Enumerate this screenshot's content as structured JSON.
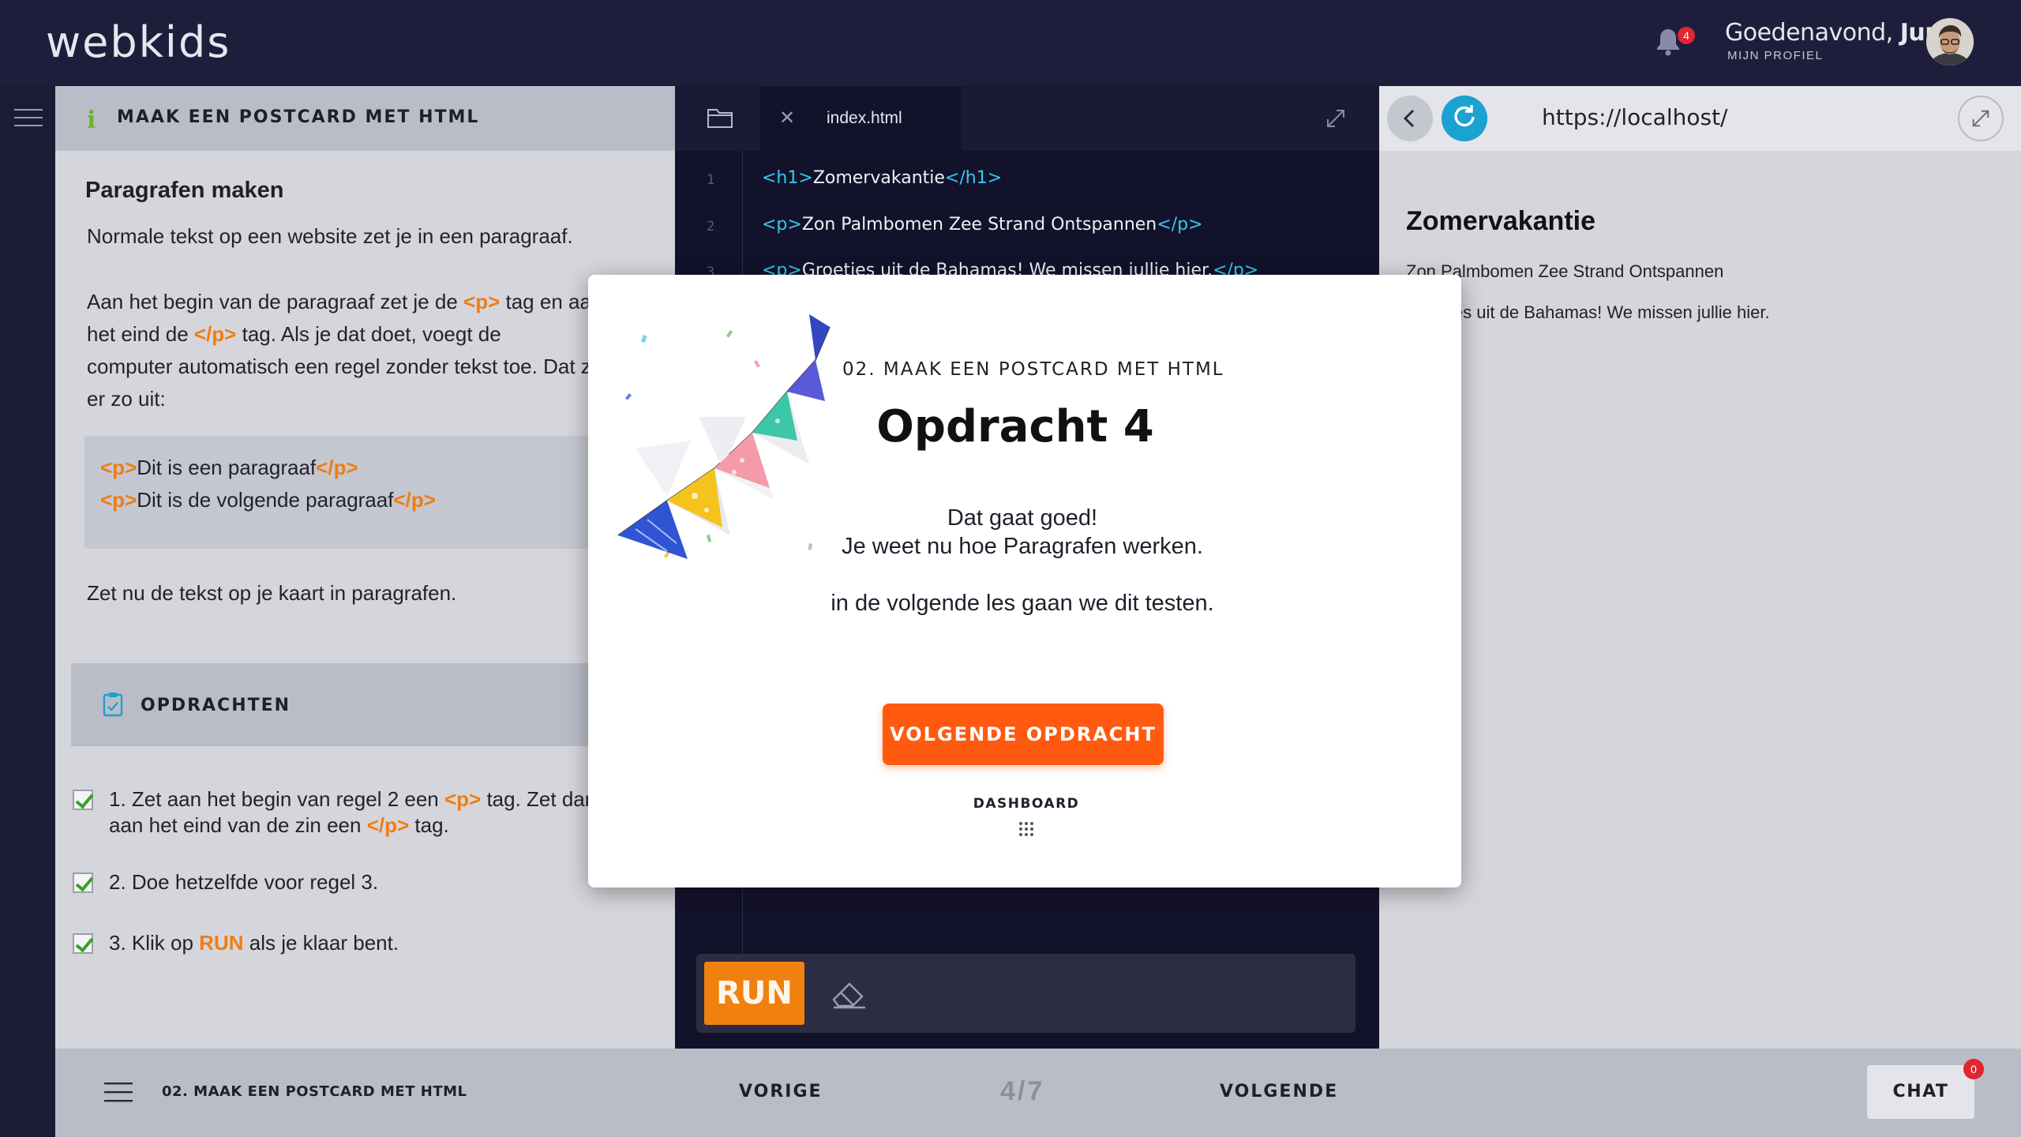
{
  "app": {
    "logo": "webkids",
    "notifications_count": "4",
    "greeting_prefix": "Goedenavond, ",
    "user_name": "Jun",
    "profile_link": "MIJN PROFIEL"
  },
  "instructions": {
    "header_title": "MAAK EEN POSTCARD MET HTML",
    "heading": "Paragrafen maken",
    "para1": "Normale tekst op een website zet je in een paragraaf.",
    "para2_a": "Aan het begin van de paragraaf zet je de ",
    "para2_tag_open": "<p>",
    "para2_b": " tag en aan",
    "para2_c": "het eind de ",
    "para2_tag_close": "</p>",
    "para2_d": " tag. Als je dat doet, voegt de",
    "para2_e": "computer automatisch een regel zonder tekst toe. Dat ziet",
    "para2_f": "er zo uit:",
    "example": [
      {
        "open": "<p>",
        "text": "Dit is een paragraaf",
        "close": "</p>"
      },
      {
        "open": "<p>",
        "text": "Dit is de volgende paragraaf",
        "close": "</p>"
      }
    ],
    "para3": "Zet nu de tekst op je kaart in paragrafen.",
    "tasks_label": "OPDRACHTEN",
    "tasks": [
      {
        "a": "1. Zet aan het begin van regel 2 een ",
        "tag1": "<p>",
        "b": " tag. Zet dan",
        "c": "aan het eind van de zin een ",
        "tag2": "</p>",
        "d": " tag."
      },
      {
        "text": "2. Doe hetzelfde voor regel 3."
      },
      {
        "a": "3. Klik op ",
        "run": "RUN",
        "b": " als je klaar bent."
      }
    ]
  },
  "editor": {
    "tab_name": "index.html",
    "lines": [
      {
        "num": "1",
        "open": "<h1>",
        "text": "Zomervakantie",
        "close": "</h1>"
      },
      {
        "num": "2",
        "open": "<p>",
        "text": "Zon Palmbomen Zee Strand Ontspannen",
        "close": "</p>"
      },
      {
        "num": "3",
        "open": "<p>",
        "text": "Groeties uit de Bahamas! We missen jullie hier.",
        "close": "</p>"
      }
    ],
    "run_label": "RUN"
  },
  "preview": {
    "url": "https://localhost/",
    "h1": "Zomervakantie",
    "p1": "Zon Palmbomen Zee Strand Ontspannen",
    "p2": "Groeties uit de Bahamas! We missen jullie hier."
  },
  "bottombar": {
    "course_title": "02. MAAK EEN POSTCARD MET HTML",
    "prev_label": "VORIGE",
    "progress": "4/7",
    "next_label": "VOLGENDE",
    "chat_label": "CHAT",
    "chat_count": "0"
  },
  "modal": {
    "subtitle": "02. MAAK EEN POSTCARD MET HTML",
    "title": "Opdracht 4",
    "line1": "Dat gaat goed!",
    "line2": "Je weet nu hoe Paragrafen werken.",
    "line3": "in de volgende les gaan we dit testen.",
    "button": "VOLGENDE OPDRACHT",
    "dashboard": "DASHBOARD"
  },
  "colors": {
    "accent_orange": "#ff5a0f",
    "run_orange": "#f0810f",
    "tag_orange": "#f07d10",
    "code_tag_cyan": "#38c7f0",
    "refresh_blue": "#1ba2d1",
    "badge_red": "#e02630"
  }
}
